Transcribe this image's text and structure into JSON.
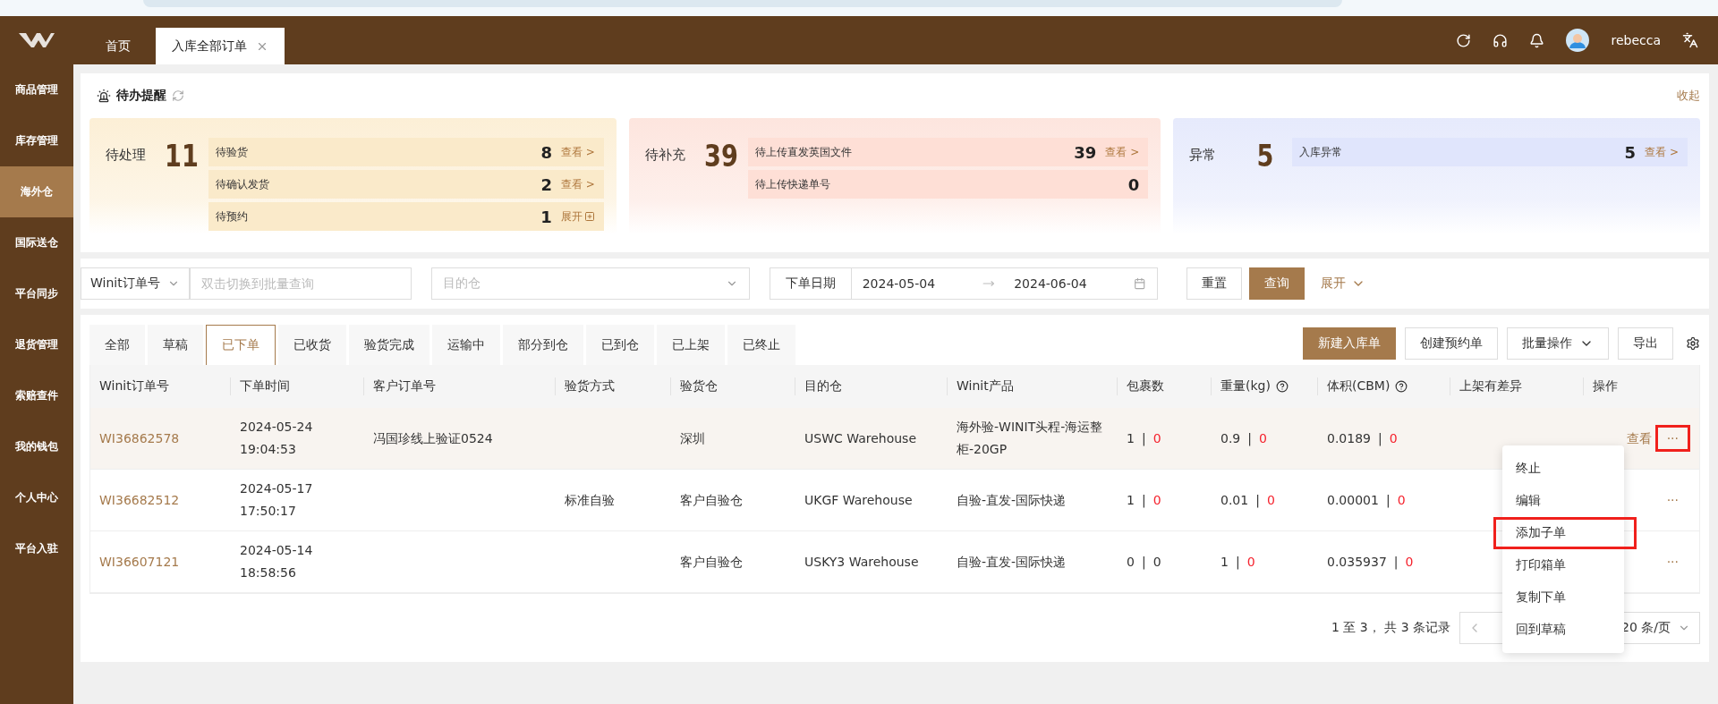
{
  "header": {
    "tabs": [
      {
        "label": "首页",
        "selected": false,
        "closable": false
      },
      {
        "label": "入库全部订单",
        "selected": true,
        "closable": true
      }
    ],
    "user": "rebecca"
  },
  "sidebar": {
    "items": [
      {
        "label": "商品管理",
        "selected": false
      },
      {
        "label": "库存管理",
        "selected": false
      },
      {
        "label": "海外仓",
        "selected": true
      },
      {
        "label": "国际送仓",
        "selected": false
      },
      {
        "label": "平台同步",
        "selected": false
      },
      {
        "label": "退货管理",
        "selected": false
      },
      {
        "label": "索赔查件",
        "selected": false
      },
      {
        "label": "我的钱包",
        "selected": false
      },
      {
        "label": "个人中心",
        "selected": false
      },
      {
        "label": "平台入驻",
        "selected": false
      }
    ]
  },
  "reminders": {
    "title": "待办提醒",
    "collapse": "收起",
    "cards": [
      {
        "color": "#fcefd6",
        "label": "待处理",
        "total": "11",
        "rows": [
          {
            "label": "待验货",
            "count": "8",
            "action": "查看 >",
            "expand_icon": false
          },
          {
            "label": "待确认发货",
            "count": "2",
            "action": "查看 >",
            "expand_icon": false
          },
          {
            "label": "待预约",
            "count": "1",
            "action": "展开",
            "expand_icon": true
          }
        ]
      },
      {
        "color": "#fde5de",
        "label": "待补充",
        "total": "39",
        "rows": [
          {
            "label": "待上传直发英国文件",
            "count": "39",
            "action": "查看 >",
            "expand_icon": false
          },
          {
            "label": "待上传快递单号",
            "count": "0"
          }
        ]
      },
      {
        "color": "#e6eafc",
        "label": "异常",
        "total": "5",
        "rows": [
          {
            "label": "入库异常",
            "count": "5",
            "action": "查看 >",
            "expand_icon": false
          }
        ]
      }
    ]
  },
  "filters": {
    "order_type": "Winit订单号",
    "batch_placeholder": "双击切换到批量查询",
    "warehouse_placeholder": "目的仓",
    "date_label": "下单日期",
    "date_from": "2024-05-04",
    "date_to": "2024-06-04",
    "reset": "重置",
    "search": "查询",
    "expand": "展开"
  },
  "tabs": [
    {
      "label": "全部",
      "selected": false
    },
    {
      "label": "草稿",
      "selected": false
    },
    {
      "label": "已下单",
      "selected": true
    },
    {
      "label": "已收货",
      "selected": false
    },
    {
      "label": "验货完成",
      "selected": false
    },
    {
      "label": "运输中",
      "selected": false
    },
    {
      "label": "部分到仓",
      "selected": false
    },
    {
      "label": "已到仓",
      "selected": false
    },
    {
      "label": "已上架",
      "selected": false
    },
    {
      "label": "已终止",
      "selected": false
    }
  ],
  "toolbar": [
    {
      "label": "新建入库单",
      "kind": "primary"
    },
    {
      "label": "创建预约单",
      "kind": "plain"
    },
    {
      "label": "批量操作",
      "kind": "dropdown"
    },
    {
      "label": "导出",
      "kind": "plain"
    }
  ],
  "table": {
    "columns": [
      {
        "label": "Winit订单号",
        "help": false
      },
      {
        "label": "下单时间",
        "help": false
      },
      {
        "label": "客户订单号",
        "help": false
      },
      {
        "label": "验货方式",
        "help": false
      },
      {
        "label": "验货仓",
        "help": false
      },
      {
        "label": "目的仓",
        "help": false
      },
      {
        "label": "Winit产品",
        "help": false
      },
      {
        "label": "包裹数",
        "help": false
      },
      {
        "label": "重量(kg)",
        "help": true
      },
      {
        "label": "体积(CBM)",
        "help": true
      },
      {
        "label": "上架有差异",
        "help": false
      },
      {
        "label": "操作",
        "help": false
      }
    ],
    "rows": [
      {
        "hovered": true,
        "order": "WI36862578",
        "date": "2024-05-24",
        "time": "19:04:53",
        "customer_order": "冯国珍线上验证0524",
        "inspect_wh": "深圳",
        "dest_wh": "USWC Warehouse",
        "product": "海外验-WINIT头程-海运整柜-20GP",
        "parcels": {
          "value": "1",
          "sep": "|",
          "diff": "0",
          "alert": true
        },
        "weight": {
          "value": "0.9",
          "sep": "|",
          "diff": "0",
          "alert": true
        },
        "volume": {
          "value": "0.0189",
          "sep": "|",
          "diff": "0",
          "alert": true
        },
        "view": "查看",
        "more": "···",
        "more_highlight": true
      },
      {
        "hovered": false,
        "order": "WI36682512",
        "date": "2024-05-17",
        "time": "17:50:17",
        "method": "标准自验",
        "inspect_wh": "客户自验仓",
        "dest_wh": "UKGF Warehouse",
        "product": "自验-直发-国际快递",
        "parcels": {
          "value": "1",
          "sep": "|",
          "diff": "0",
          "alert": true
        },
        "weight": {
          "value": "0.01",
          "sep": "|",
          "diff": "0",
          "alert": true
        },
        "volume": {
          "value": "0.00001",
          "sep": "|",
          "diff": "0",
          "alert": true
        },
        "more": "···",
        "more_highlight": false
      },
      {
        "hovered": false,
        "order": "WI36607121",
        "date": "2024-05-14",
        "time": "18:58:56",
        "inspect_wh": "客户自验仓",
        "dest_wh": "USKY3 Warehouse",
        "product": "自验-直发-国际快递",
        "parcels": {
          "value": "0",
          "sep": "|",
          "diff": "0",
          "alert": false
        },
        "weight": {
          "value": "1",
          "sep": "|",
          "diff": "0",
          "alert": true
        },
        "volume": {
          "value": "0.035937",
          "sep": "|",
          "diff": "0",
          "alert": true
        },
        "more": "···",
        "more_highlight": false
      }
    ]
  },
  "menu": [
    {
      "label": "终止",
      "highlight": false
    },
    {
      "label": "编辑",
      "highlight": false
    },
    {
      "label": "添加子单",
      "highlight": true
    },
    {
      "label": "打印箱单",
      "highlight": false
    },
    {
      "label": "复制下单",
      "highlight": false
    },
    {
      "label": "回到草稿",
      "highlight": false
    }
  ],
  "pagination": {
    "summary": "1 至 3， 共 3 条记录",
    "page_size": "20 条/页"
  }
}
